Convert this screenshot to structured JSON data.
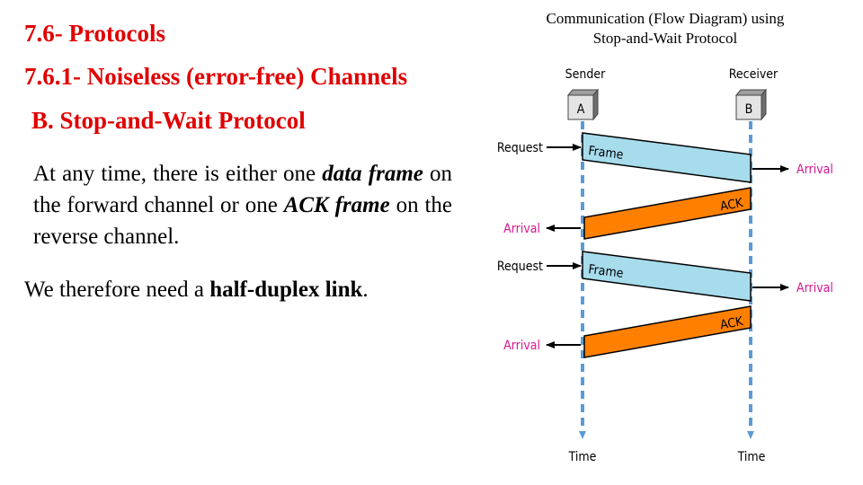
{
  "headings": {
    "section": "7.6- Protocols",
    "subsection": "7.6.1- Noiseless (error-free) Channels",
    "topic": "B. Stop-and-Wait Protocol"
  },
  "paragraph1": {
    "t1": "At any time, there is either one ",
    "e1": "data frame",
    "t2": " on the forward channel or one ",
    "e2": "ACK frame",
    "t3": " on the reverse channel."
  },
  "paragraph2": {
    "t1": "We therefore need a ",
    "b1": "half-duplex link",
    "t2": "."
  },
  "diagram": {
    "caption_line1": "Communication (Flow Diagram) using",
    "caption_line2": "Stop-and-Wait Protocol",
    "sender": {
      "label": "Sender",
      "node": "A"
    },
    "receiver": {
      "label": "Receiver",
      "node": "B"
    },
    "time_label": "Time",
    "colors": {
      "frame": "#a6dcec",
      "ack": "#ff8000",
      "timeline": "#5b9bd5",
      "arrival_text": "#d6168f"
    },
    "exchanges": [
      {
        "request": "Request",
        "frame": "Frame",
        "receiver_arrival": "Arrival",
        "ack": "ACK",
        "sender_arrival": "Arrival"
      },
      {
        "request": "Request",
        "frame": "Frame",
        "receiver_arrival": "Arrival",
        "ack": "ACK",
        "sender_arrival": "Arrival"
      }
    ]
  }
}
